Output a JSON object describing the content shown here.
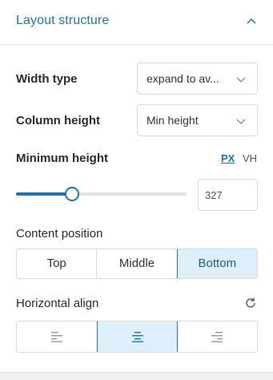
{
  "section": {
    "title": "Layout structure"
  },
  "width_type": {
    "label": "Width type",
    "value": "expand to av..."
  },
  "column_height": {
    "label": "Column height",
    "value": "Min height"
  },
  "minimum_height": {
    "label": "Minimum height",
    "units": [
      "PX",
      "VH"
    ],
    "selected_unit": "PX",
    "value": "327",
    "slider_fraction": 0.33
  },
  "content_position": {
    "label": "Content position",
    "options": [
      "Top",
      "Middle",
      "Bottom"
    ],
    "selected": "Bottom"
  },
  "horizontal_align": {
    "label": "Horizontal align",
    "options": [
      "left",
      "center",
      "right"
    ],
    "selected": "center"
  },
  "colors": {
    "accent": "#1f75ad",
    "active_bg": "#dfeefb"
  },
  "icons": {
    "section_toggle": "chevron-up-icon",
    "select_arrow": "chevron-down-icon",
    "reset": "reset-icon",
    "align_left": "align-left-icon",
    "align_center": "align-center-icon",
    "align_right": "align-right-icon"
  }
}
